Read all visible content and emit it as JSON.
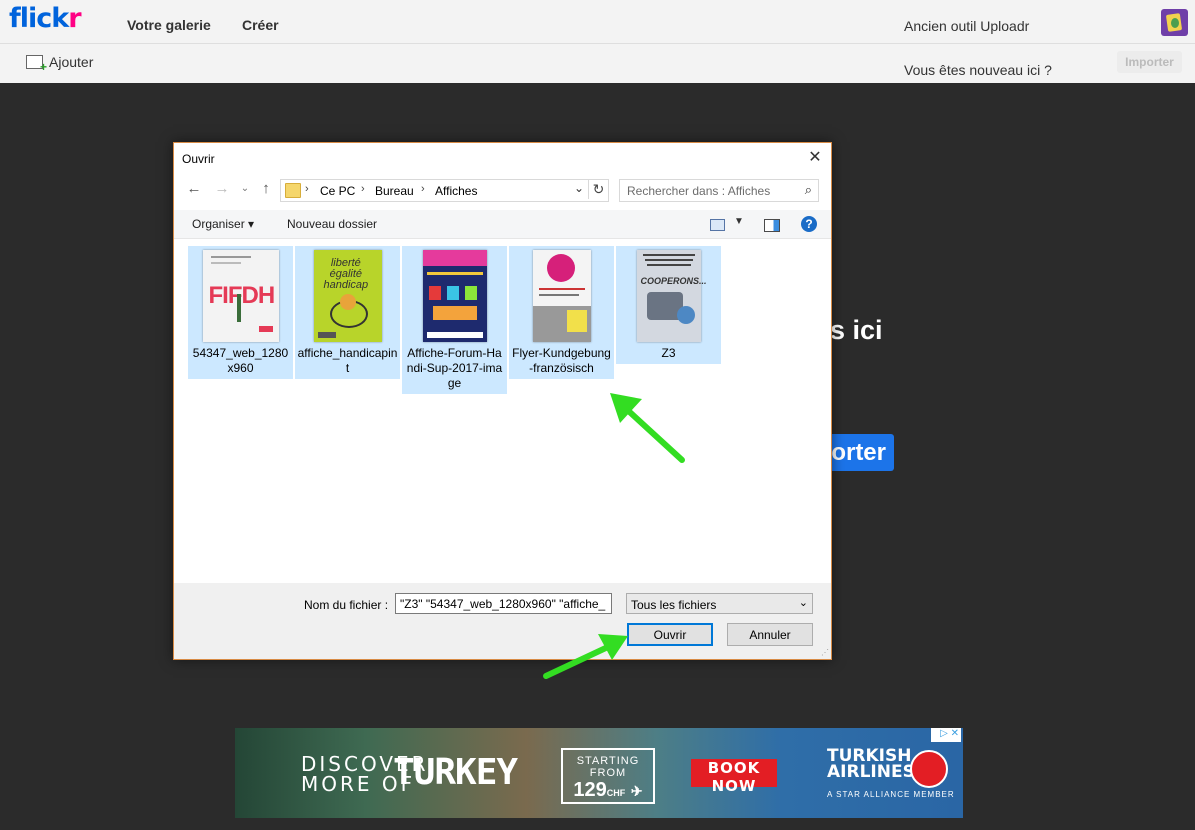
{
  "header": {
    "logo_a": "flick",
    "logo_b": "r",
    "nav": [
      "Votre galerie",
      "Créer"
    ],
    "old_tool": "Ancien outil Uploadr"
  },
  "subbar": {
    "add_label": "Ajouter",
    "new_here": "Vous êtes nouveau ici ?",
    "import_label": "Importer"
  },
  "background": {
    "text_fragment": "s ici",
    "button_fragment": "orter"
  },
  "dialog": {
    "title": "Ouvrir",
    "close_glyph": "✕",
    "path": [
      "Ce PC",
      "Bureau",
      "Affiches"
    ],
    "search_placeholder": "Rechercher dans : Affiches",
    "toolbar": {
      "organize": "Organiser ▾",
      "new_folder": "Nouveau dossier"
    },
    "files": [
      {
        "name": "54347_web_1280x960",
        "selected": true
      },
      {
        "name": "affiche_handicapint",
        "selected": true
      },
      {
        "name": "Affiche-Forum-Handi-Sup-2017-image",
        "selected": true
      },
      {
        "name": "Flyer-Kundgebung-französisch",
        "selected": true
      },
      {
        "name": "Z3",
        "selected": true
      }
    ],
    "filename_label": "Nom du fichier :",
    "filename_value": "\"Z3\" \"54347_web_1280x960\" \"affiche_",
    "filetype": "Tous les fichiers",
    "open_label": "Ouvrir",
    "cancel_label": "Annuler"
  },
  "ad": {
    "discover": "DISCOVER",
    "more_of": "MORE OF",
    "turkey": "TURKEY",
    "starting_from": "STARTING FROM",
    "price": "129",
    "currency": "CHF",
    "book_now": "BOOK NOW",
    "airline_1": "TURKISH",
    "airline_2": "AIRLINES",
    "alliance": "A STAR ALLIANCE MEMBER"
  },
  "colors": {
    "accent": "#0078d7",
    "flickr_blue": "#0063dc",
    "flickr_pink": "#ff0084",
    "selection": "#cce8ff",
    "arrow_green": "#33dd22"
  }
}
